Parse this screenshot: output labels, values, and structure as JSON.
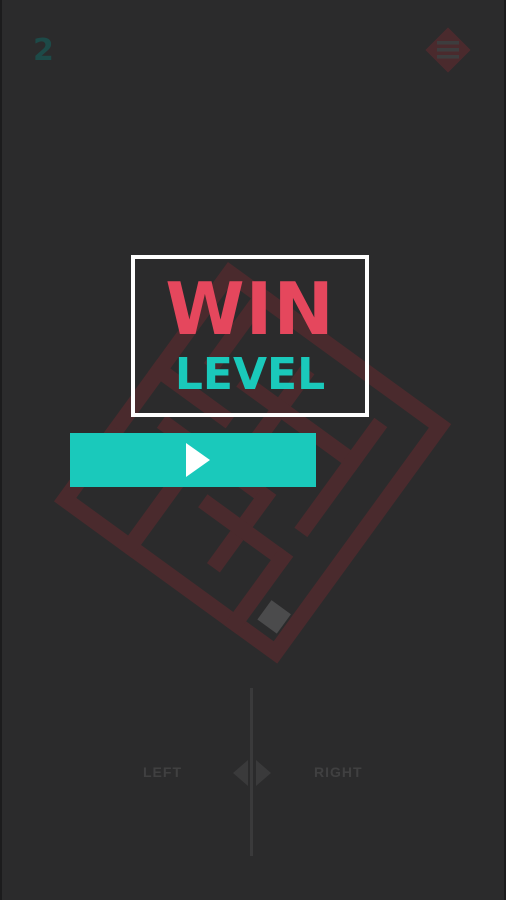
{
  "hud": {
    "level_number": "2",
    "menu_icon": "hamburger-menu-icon"
  },
  "win_panel": {
    "title": "WIN",
    "subtitle": "LEVEL",
    "play_icon": "play-icon"
  },
  "controls": {
    "left_label": "LEFT",
    "right_label": "RIGHT",
    "arrows_icon": "left-right-arrows-icon"
  },
  "colors": {
    "background": "#2b2b2c",
    "win_title": "#e5475d",
    "win_subtitle": "#1ac9bb",
    "play_button": "#1ac9bb",
    "maze_walls": "#4a2a2d",
    "menu_diamond": "#4a2a2d",
    "level_number": "#1d4a48"
  }
}
